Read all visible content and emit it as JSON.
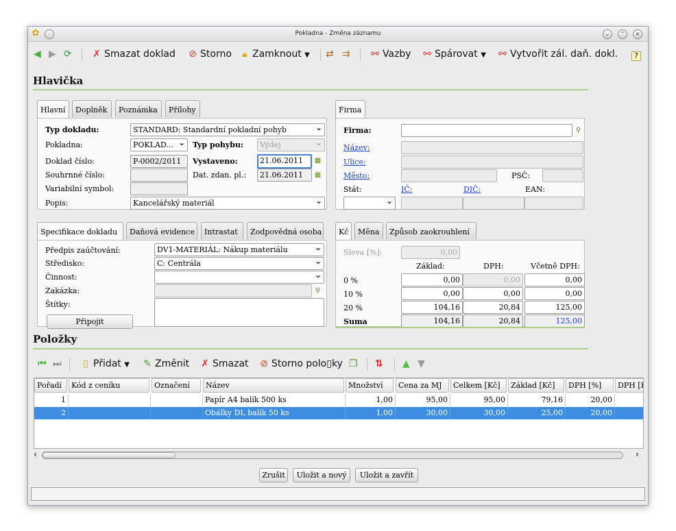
{
  "window": {
    "title": "Pokladna - Změna záznamu"
  },
  "toolbar": {
    "smazat": "Smazat doklad",
    "storno": "Storno",
    "zamknout": "Zamknout",
    "vazby": "Vazby",
    "sparovat": "Spárovat",
    "vytvorit": "Vytvořit zál. daň. dokl."
  },
  "hlavicka": {
    "title": "Hlavička",
    "tabs": [
      "Hlavní",
      "Doplněk",
      "Poznámka",
      "Přílohy"
    ],
    "firma_tab": "Firma",
    "labels": {
      "typ_dokladu": "Typ dokladu:",
      "pokladna": "Pokladna:",
      "typ_pohybu": "Typ pohybu:",
      "doklad_cislo": "Doklad číslo:",
      "vystaveno": "Vystaveno:",
      "souhrnne": "Souhrnné číslo:",
      "dat_zdan": "Dat. zdan. pl.:",
      "varsym": "Variabilní symbol:",
      "popis": "Popis:"
    },
    "values": {
      "typ_dokladu": "STANDARD: Standardní pokladní pohyb",
      "pokladna": "POKLAD...",
      "typ_pohybu": "Výdej",
      "doklad_cislo": "P-0002/2011",
      "vystaveno": "21.06.2011",
      "souhrnne": "",
      "dat_zdan": "21.06.2011",
      "varsym": "",
      "popis": "Kancelářský materiál"
    },
    "firma": {
      "firma": "Firma:",
      "nazev": "Název:",
      "ulice": "Ulice:",
      "mesto": "Město:",
      "psc": "PSČ:",
      "stat": "Stát:",
      "ic": "IČ:",
      "dic": "DIČ:",
      "ean": "EAN:"
    }
  },
  "spec": {
    "tabs": [
      "Specifikace dokladu",
      "Daňová evidence",
      "Intrastat",
      "Zodpovědná osoba"
    ],
    "labels": {
      "predpis": "Předpis zaúčtování:",
      "stredisko": "Středisko:",
      "cinnost": "Činnost:",
      "zakazka": "Zakázka:",
      "stitky": "Štítky:"
    },
    "values": {
      "predpis": "DV1-MATERIÁL: Nákup materiálu",
      "stredisko": "C: Centrála",
      "cinnost": "",
      "zakazka": ""
    },
    "pripojit": "Připojit"
  },
  "dph": {
    "tabs": [
      "Kč",
      "Měna",
      "Způsob zaokrouhlení"
    ],
    "sleva_label": "Sleva [%]:",
    "sleva": "0,00",
    "headers": [
      "Základ:",
      "DPH:",
      "Včetně DPH:"
    ],
    "rows": [
      {
        "label": "0 %",
        "zaklad": "0,00",
        "dph": "0,00",
        "celkem": "0,00"
      },
      {
        "label": "10 %",
        "zaklad": "0,00",
        "dph": "0,00",
        "celkem": "0,00"
      },
      {
        "label": "20 %",
        "zaklad": "104,16",
        "dph": "20,84",
        "celkem": "125,00"
      },
      {
        "label": "Suma",
        "zaklad": "104,16",
        "dph": "20,84",
        "celkem": "125,00"
      }
    ]
  },
  "polozky": {
    "title": "Položky",
    "toolbar": {
      "pridat": "Přidat",
      "zmenit": "Změnit",
      "smazat": "Smazat",
      "storno": "Storno polo▯ky"
    },
    "columns": [
      "Pořadí",
      "Kód z ceníku",
      "Označení",
      "Název",
      "Množství",
      "Cena za MJ",
      "Celkem [Kč]",
      "Základ [Kč]",
      "DPH [%]",
      "DPH [K"
    ],
    "rows": [
      {
        "poradi": "1",
        "kod": "",
        "oznaceni": "",
        "nazev": "Papír A4 balík 500 ks",
        "mnozstvi": "1,00",
        "cena": "95,00",
        "celkem": "95,00",
        "zaklad": "79,16",
        "dph": "20,00"
      },
      {
        "poradi": "2",
        "kod": "",
        "oznaceni": "",
        "nazev": "Obálky DL balík 50 ks",
        "mnozstvi": "1,00",
        "cena": "30,00",
        "celkem": "30,00",
        "zaklad": "25,00",
        "dph": "20,00"
      }
    ]
  },
  "buttons": {
    "zrusit": "Zrušit",
    "ulozit_novy": "Uložit a nový",
    "ulozit_zavrit": "Uložit a zavřít"
  },
  "colors": {
    "selection": "#3d8ee0",
    "link": "#1a3fb8",
    "accent_line": "#a9cf8a"
  }
}
